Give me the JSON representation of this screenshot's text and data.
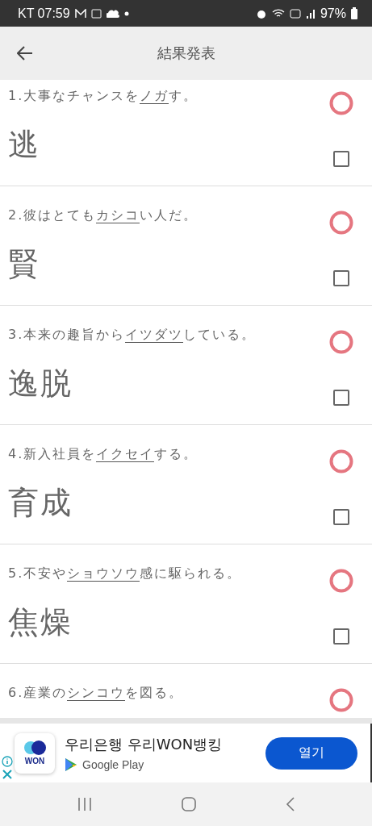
{
  "status_bar": {
    "carrier_time": "KT 07:59",
    "battery": "97%"
  },
  "header": {
    "title": "結果発表"
  },
  "questions": [
    {
      "before": "1.大事なチャンスを",
      "target": "ノガ",
      "after": "す。",
      "answer": "逃",
      "correct": true,
      "checked": false
    },
    {
      "before": "2.彼はとても",
      "target": "カシコ",
      "after": "い人だ。",
      "answer": "賢",
      "correct": true,
      "checked": false
    },
    {
      "before": "3.本来の趣旨から",
      "target": "イツダツ",
      "after": "している。",
      "answer": "逸脱",
      "correct": true,
      "checked": false
    },
    {
      "before": "4.新入社員を",
      "target": "イクセイ",
      "after": "する。",
      "answer": "育成",
      "correct": true,
      "checked": false
    },
    {
      "before": "5.不安や",
      "target": "ショウソウ",
      "after": "感に駆られる。",
      "answer": "焦燥",
      "correct": true,
      "checked": false
    },
    {
      "before": "6.産業の",
      "target": "シンコウ",
      "after": "を図る。",
      "correct": true
    }
  ],
  "ad": {
    "app_name": "우리은행 우리WON뱅킹",
    "logo_text": "WON",
    "store": "Google Play",
    "button": "열기"
  }
}
